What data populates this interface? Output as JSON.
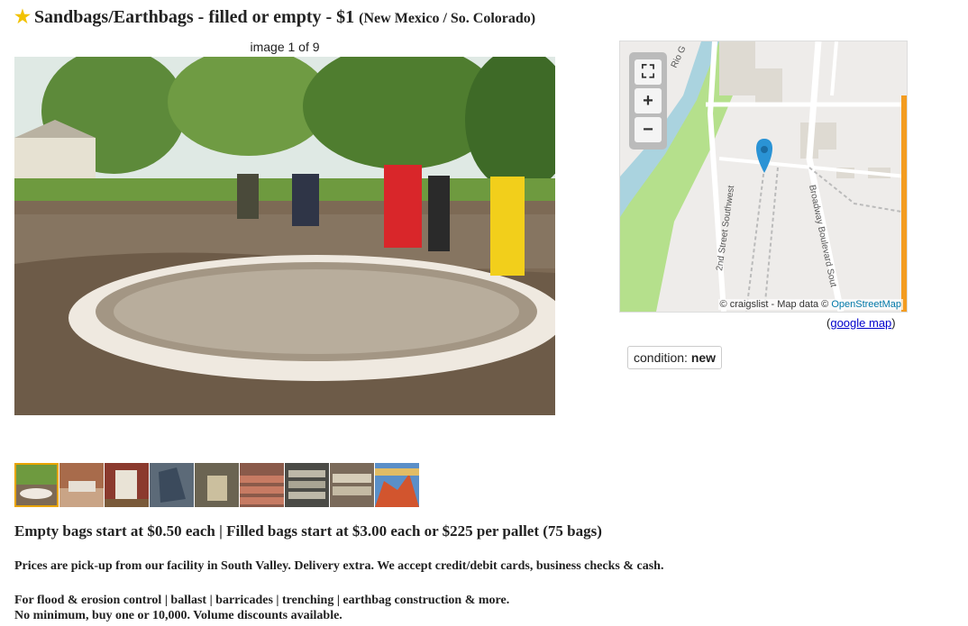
{
  "title": {
    "star_icon": "star-icon",
    "text": "Sandbags/Earthbags - filled or empty - $1",
    "location": "(New Mexico / So. Colorado)"
  },
  "gallery": {
    "counter": "image 1 of 9",
    "thumbnail_count": 9,
    "selected_index": 0
  },
  "map": {
    "streets": [
      "2nd Street Southwest",
      "Broadway Boulevard Sout"
    ],
    "river_label": "Rio G",
    "controls": {
      "fullscreen_icon": "fullscreen-icon",
      "zoom_in": "+",
      "zoom_out": "−"
    },
    "attribution_prefix": "© craigslist - Map data ©",
    "attribution_link": "OpenStreetMap",
    "google_map_open": "(",
    "google_map_link": "google map",
    "google_map_close": ")"
  },
  "attributes": {
    "condition_label": "condition:",
    "condition_value": "new"
  },
  "body": {
    "headline": "Empty bags start at $0.50 each | Filled bags start at $3.00 each or $225 per pallet (75 bags)",
    "paragraph1": "Prices are pick-up from our facility in South Valley. Delivery extra. We accept credit/debit cards, business checks & cash.",
    "paragraph2_line1": "For flood & erosion control | ballast | barricades | trenching | earthbag construction & more.",
    "paragraph2_line2": "No minimum, buy one or 10,000. Volume discounts available."
  },
  "colors": {
    "star": "#f2c200",
    "link": "#0000cc",
    "thumb_selected": "#e8a400",
    "map_pin": "#2a93d5",
    "river": "#aad3df",
    "park": "#b5e08c"
  }
}
